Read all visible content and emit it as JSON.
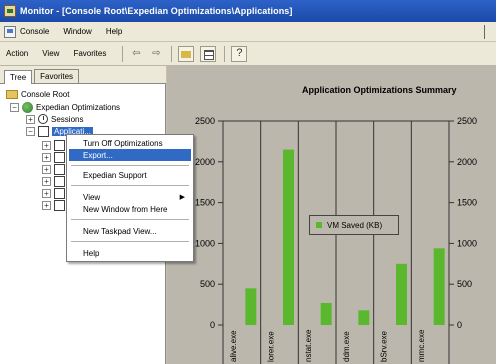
{
  "window": {
    "title": "Monitor - [Console Root\\Expedian Optimizations\\Applications]"
  },
  "menubar": {
    "items": [
      "Console",
      "Window",
      "Help"
    ]
  },
  "toolbar": {
    "items": [
      "Action",
      "View",
      "Favorites"
    ],
    "back_icon": "back-arrow-icon",
    "forward_icon": "forward-arrow-icon"
  },
  "tabs": [
    "Tree",
    "Favorites"
  ],
  "tree": {
    "root": "Console Root",
    "expedian": "Expedian Optimizations",
    "sessions": "Sessions",
    "applications": "Applicati..."
  },
  "context_menu": {
    "items": [
      {
        "label": "Turn Off Optimizations",
        "highlighted": false,
        "submenu": false
      },
      {
        "label": "Export...",
        "highlighted": true,
        "submenu": false
      },
      {
        "label": "Expedian Support",
        "highlighted": false,
        "submenu": false
      },
      {
        "label": "View",
        "highlighted": false,
        "submenu": true
      },
      {
        "label": "New Window from Here",
        "highlighted": false,
        "submenu": false
      },
      {
        "label": "New Taskpad View...",
        "highlighted": false,
        "submenu": false
      },
      {
        "label": "Help",
        "highlighted": false,
        "submenu": false
      }
    ]
  },
  "chart_data": {
    "type": "bar",
    "title": "Application Optimizations Summary",
    "categories": [
      "alive.exe",
      "lorer.exe",
      "nstat.exe",
      "ddm.exe",
      "bSrv.exe",
      "mmc.exe"
    ],
    "series": [
      {
        "name": "VM Saved (KB)",
        "values": [
          450,
          2150,
          270,
          180,
          750,
          940
        ],
        "color": "#5bb82e"
      }
    ],
    "ylim": [
      0,
      2500
    ],
    "yticks": [
      0,
      500,
      1000,
      1500,
      2000,
      2500
    ],
    "grid": true,
    "legend_position": "center-right"
  }
}
